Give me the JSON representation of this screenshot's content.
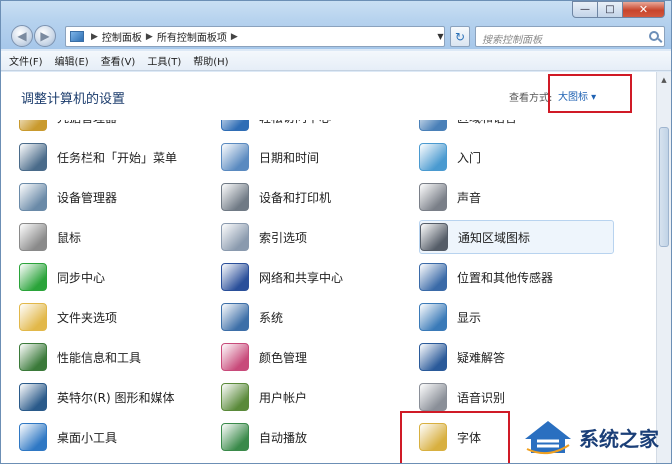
{
  "window": {
    "caption": {
      "minimize": "—",
      "maximize": "□",
      "close": "✕"
    }
  },
  "navbar": {
    "back": "◀",
    "forward": "▶",
    "breadcrumb": [
      "控制面板",
      "所有控制面板项"
    ],
    "refresh": "↻",
    "search_placeholder": "搜索控制面板"
  },
  "menubar": {
    "items": [
      "文件(F)",
      "编辑(E)",
      "查看(V)",
      "工具(T)",
      "帮助(H)"
    ]
  },
  "content": {
    "heading": "调整计算机的设置",
    "view_by_label": "查看方式:",
    "view_by_value": "大图标 ▾"
  },
  "items": {
    "col1": [
      {
        "label": "凭据管理器",
        "icon": "credential-icon",
        "color": "#c99a2e"
      },
      {
        "label": "任务栏和「开始」菜单",
        "icon": "taskbar-icon",
        "color": "#4a6b8a"
      },
      {
        "label": "设备管理器",
        "icon": "device-manager-icon",
        "color": "#6a8aa8"
      },
      {
        "label": "鼠标",
        "icon": "mouse-icon",
        "color": "#8a8a8a"
      },
      {
        "label": "同步中心",
        "icon": "sync-icon",
        "color": "#2aa43a"
      },
      {
        "label": "文件夹选项",
        "icon": "folder-icon",
        "color": "#e2b84a"
      },
      {
        "label": "性能信息和工具",
        "icon": "performance-icon",
        "color": "#3b7a3a"
      },
      {
        "label": "英特尔(R) 图形和媒体",
        "icon": "intel-graphics-icon",
        "color": "#2a5a8a"
      },
      {
        "label": "桌面小工具",
        "icon": "gadgets-icon",
        "color": "#2f78c4"
      }
    ],
    "col2": [
      {
        "label": "轻松访问中心",
        "icon": "ease-of-access-icon",
        "color": "#2f6db5"
      },
      {
        "label": "日期和时间",
        "icon": "datetime-icon",
        "color": "#5a8ac0"
      },
      {
        "label": "设备和打印机",
        "icon": "printer-icon",
        "color": "#707a85"
      },
      {
        "label": "索引选项",
        "icon": "indexing-icon",
        "color": "#8a9aae"
      },
      {
        "label": "网络和共享中心",
        "icon": "network-icon",
        "color": "#2a4f9a"
      },
      {
        "label": "系统",
        "icon": "system-icon",
        "color": "#3d6fa8"
      },
      {
        "label": "颜色管理",
        "icon": "color-management-icon",
        "color": "#c84a7a"
      },
      {
        "label": "用户帐户",
        "icon": "user-accounts-icon",
        "color": "#5a8a3a"
      },
      {
        "label": "自动播放",
        "icon": "autoplay-icon",
        "color": "#3a8a4a"
      }
    ],
    "col3": [
      {
        "label": "区域和语言",
        "icon": "region-icon",
        "color": "#4a80b8"
      },
      {
        "label": "入门",
        "icon": "getting-started-icon",
        "color": "#4a9ad0"
      },
      {
        "label": "声音",
        "icon": "sound-icon",
        "color": "#7a7f88"
      },
      {
        "label": "通知区域图标",
        "icon": "notification-icon",
        "color": "#555d68"
      },
      {
        "label": "位置和其他传感器",
        "icon": "sensor-icon",
        "color": "#3a6aa8"
      },
      {
        "label": "显示",
        "icon": "display-icon",
        "color": "#3a7ab8"
      },
      {
        "label": "疑难解答",
        "icon": "troubleshooting-icon",
        "color": "#2a5a9a"
      },
      {
        "label": "语音识别",
        "icon": "microphone-icon",
        "color": "#8a8f98"
      },
      {
        "label": "字体",
        "icon": "fonts-icon",
        "color": "#d8b040"
      }
    ]
  },
  "watermark": {
    "text": "系统之家"
  },
  "colors": {
    "highlight": "#d01a26",
    "link": "#1f62b3",
    "heading": "#1c3d6d"
  }
}
